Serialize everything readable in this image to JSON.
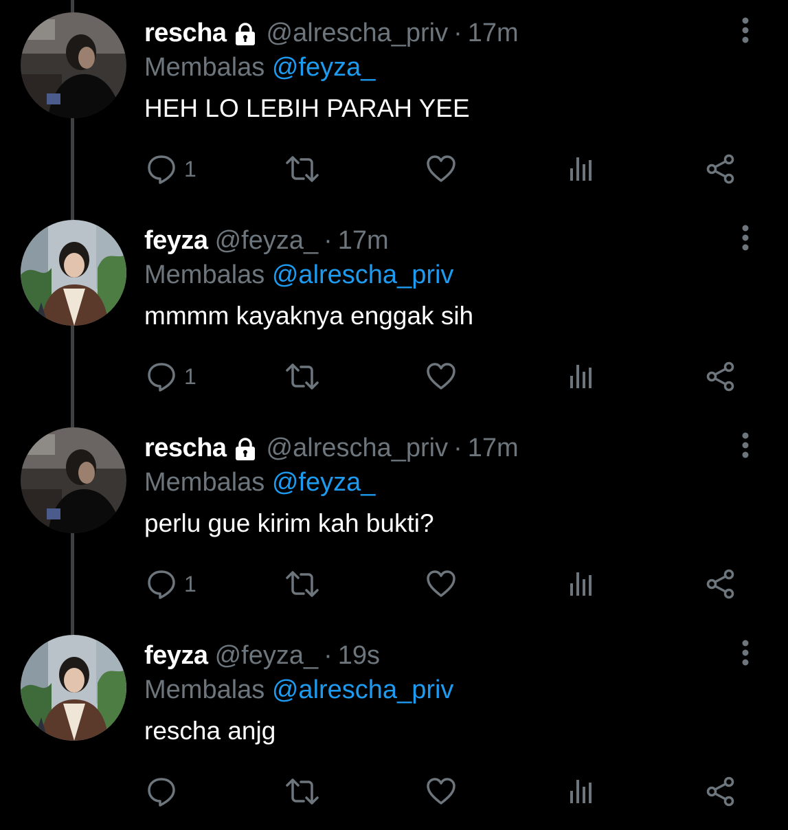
{
  "reply_prefix": "Membalas",
  "separator": "·",
  "tweets": [
    {
      "name": "rescha",
      "protected": true,
      "handle": "@alrescha_priv",
      "time": "17m",
      "reply_to": "@feyza_",
      "text": "HEH LO LEBIH PARAH YEE",
      "reply_count": "1"
    },
    {
      "name": "feyza",
      "protected": false,
      "handle": "@feyza_",
      "time": "17m",
      "reply_to": "@alrescha_priv",
      "text": "mmmm kayaknya enggak sih",
      "reply_count": "1"
    },
    {
      "name": "rescha",
      "protected": true,
      "handle": "@alrescha_priv",
      "time": "17m",
      "reply_to": "@feyza_",
      "text": "perlu gue kirim kah bukti?",
      "reply_count": "1"
    },
    {
      "name": "feyza",
      "protected": false,
      "handle": "@feyza_",
      "time": "19s",
      "reply_to": "@alrescha_priv",
      "text": "rescha anjg",
      "reply_count": ""
    }
  ],
  "icons": {
    "reply": "speech-bubble-icon",
    "retweet": "retweet-icon",
    "like": "heart-icon",
    "analytics": "bar-chart-icon",
    "share": "share-icon",
    "more": "vertical-dots-icon",
    "protected": "lock-icon"
  },
  "colors": {
    "background": "#000000",
    "name": "#ffffff",
    "secondary": "#6e767d",
    "link": "#1d9bf0",
    "thread_line": "#3e4144"
  }
}
